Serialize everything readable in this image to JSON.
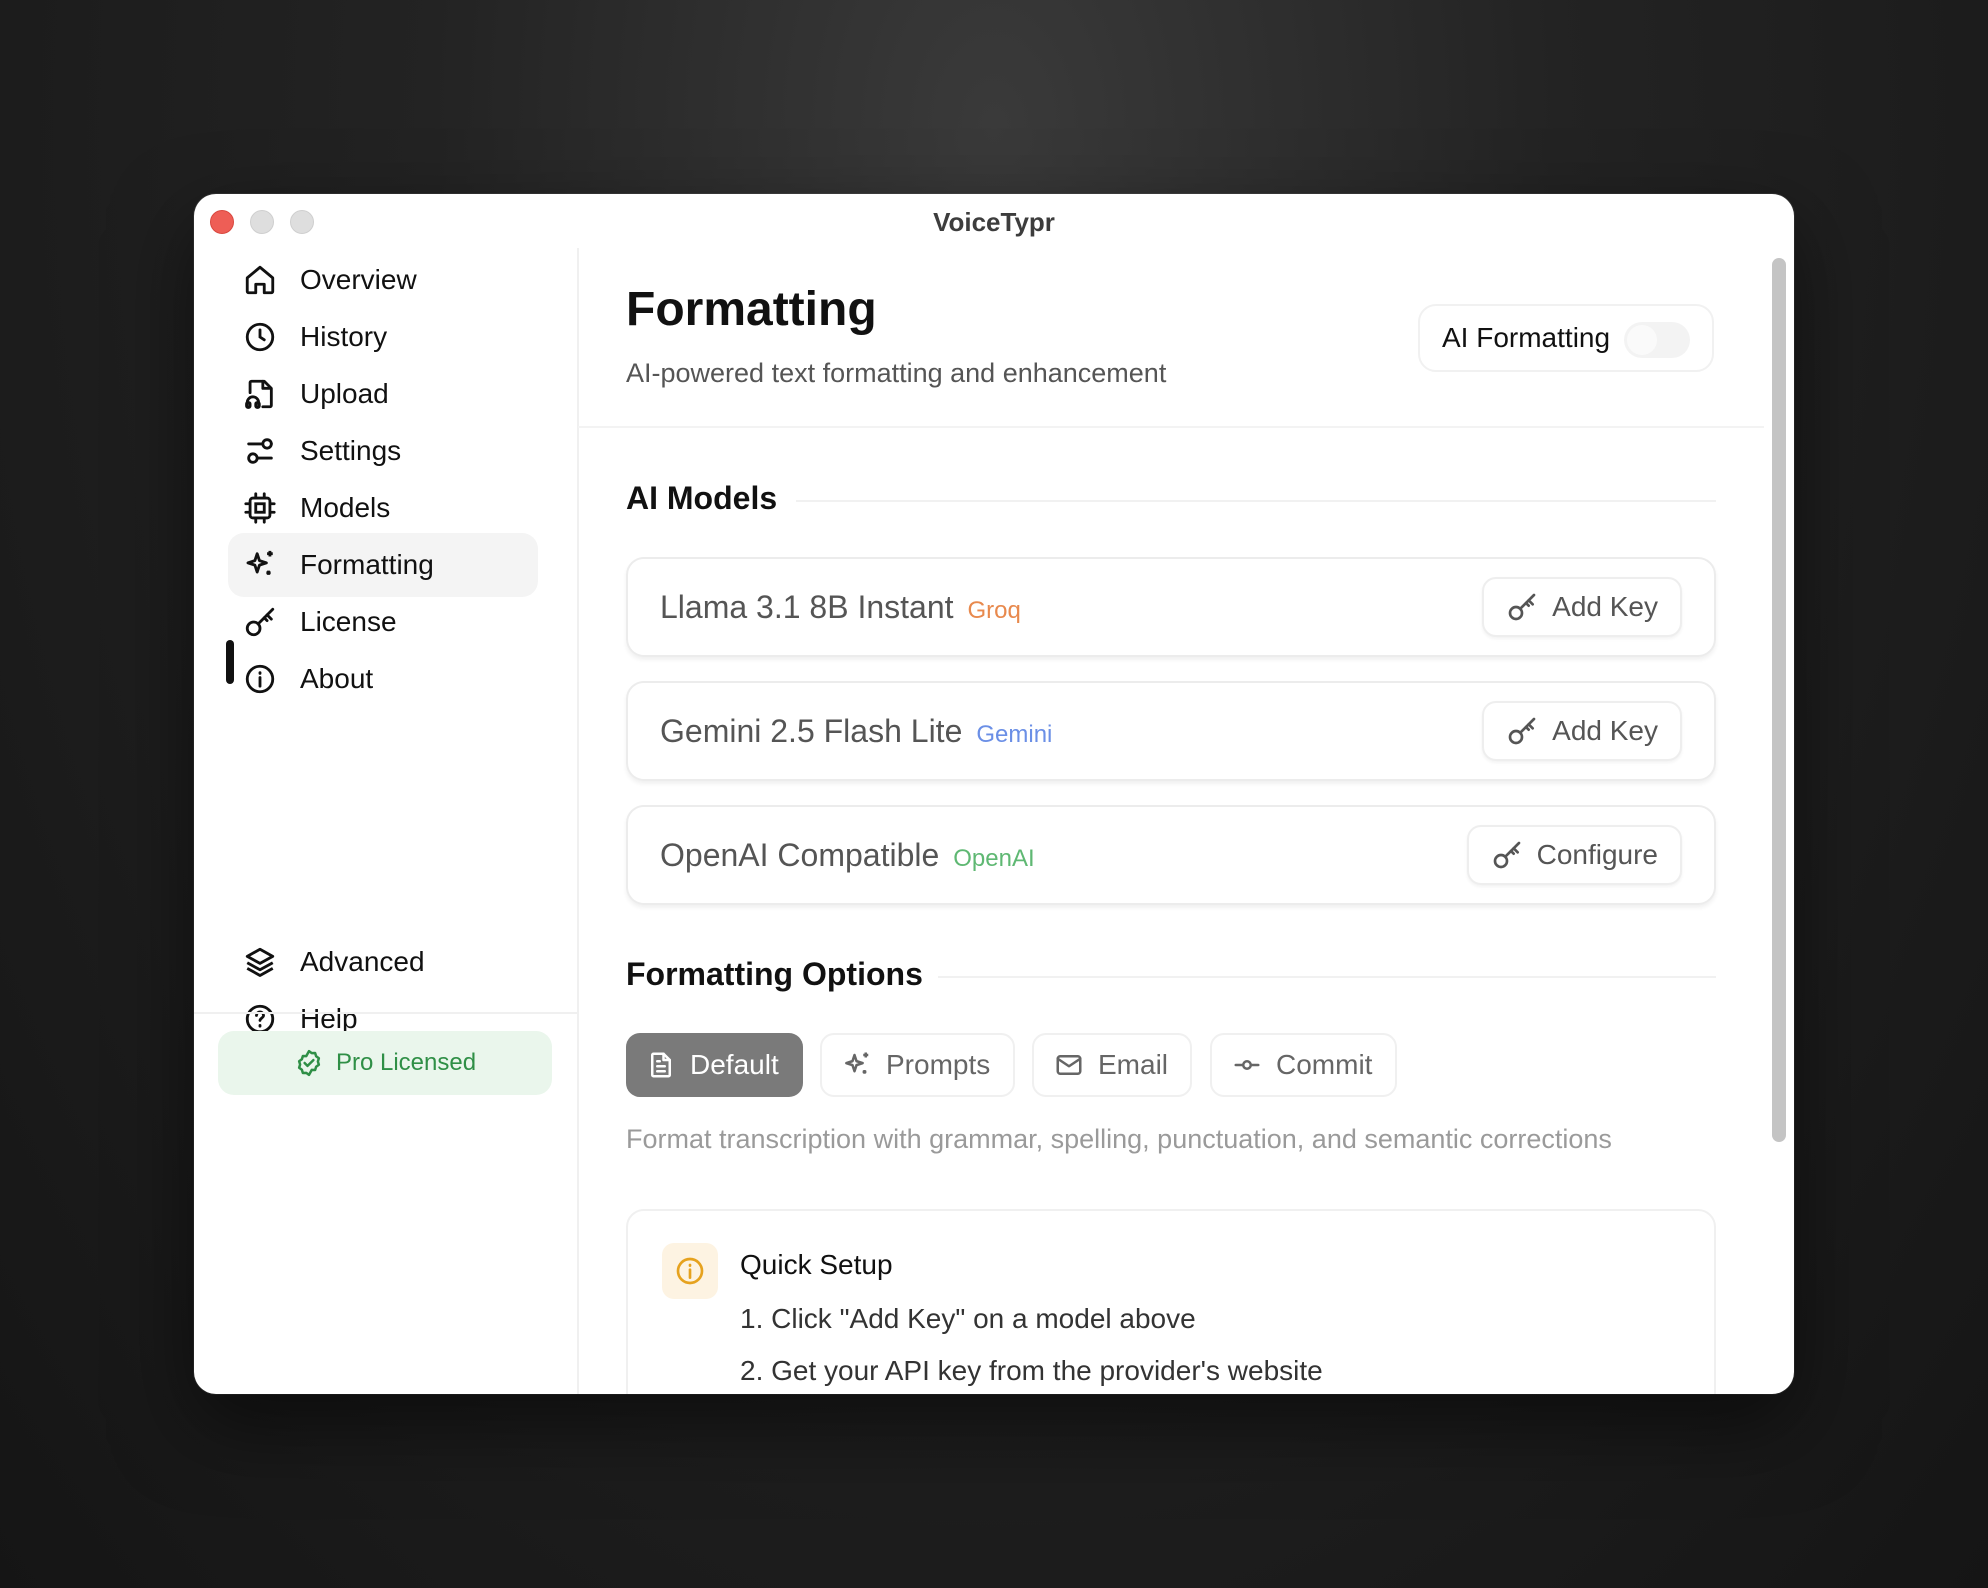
{
  "window": {
    "title": "VoiceTypr"
  },
  "sidebar": {
    "items": [
      {
        "label": "Overview",
        "icon": "home-icon"
      },
      {
        "label": "History",
        "icon": "clock-icon"
      },
      {
        "label": "Upload",
        "icon": "file-audio-icon"
      },
      {
        "label": "Settings",
        "icon": "sliders-icon"
      },
      {
        "label": "Models",
        "icon": "cpu-icon"
      },
      {
        "label": "Formatting",
        "icon": "sparkles-icon",
        "active": true
      },
      {
        "label": "License",
        "icon": "key-icon"
      },
      {
        "label": "About",
        "icon": "info-icon"
      }
    ],
    "bottom_items": [
      {
        "label": "Advanced",
        "icon": "layers-icon"
      },
      {
        "label": "Help",
        "icon": "help-circle-icon"
      }
    ],
    "license_badge": {
      "label": "Pro Licensed",
      "color": "#2f8f46"
    }
  },
  "header": {
    "title": "Formatting",
    "subtitle": "AI-powered text formatting and enhancement",
    "ai_toggle": {
      "label": "AI Formatting",
      "enabled": false
    }
  },
  "models_section": {
    "title": "AI Models",
    "models": [
      {
        "name": "Llama 3.1 8B Instant",
        "provider": "Groq",
        "provider_color": "#e8894d",
        "action": "Add Key"
      },
      {
        "name": "Gemini 2.5 Flash Lite",
        "provider": "Gemini",
        "provider_color": "#6b8fe6",
        "action": "Add Key"
      },
      {
        "name": "OpenAI Compatible",
        "provider": "OpenAI",
        "provider_color": "#5fb873",
        "action": "Configure"
      }
    ]
  },
  "formatting_options": {
    "title": "Formatting Options",
    "tabs": [
      {
        "label": "Default",
        "icon": "file-text-icon",
        "active": true
      },
      {
        "label": "Prompts",
        "icon": "sparkles-icon",
        "active": false
      },
      {
        "label": "Email",
        "icon": "mail-icon",
        "active": false
      },
      {
        "label": "Commit",
        "icon": "git-commit-icon",
        "active": false
      }
    ],
    "description": "Format transcription with grammar, spelling, punctuation, and semantic corrections"
  },
  "quick_setup": {
    "title": "Quick Setup",
    "steps": [
      "1. Click \"Add Key\" on a model above",
      "2. Get your API key from the provider's website"
    ]
  }
}
